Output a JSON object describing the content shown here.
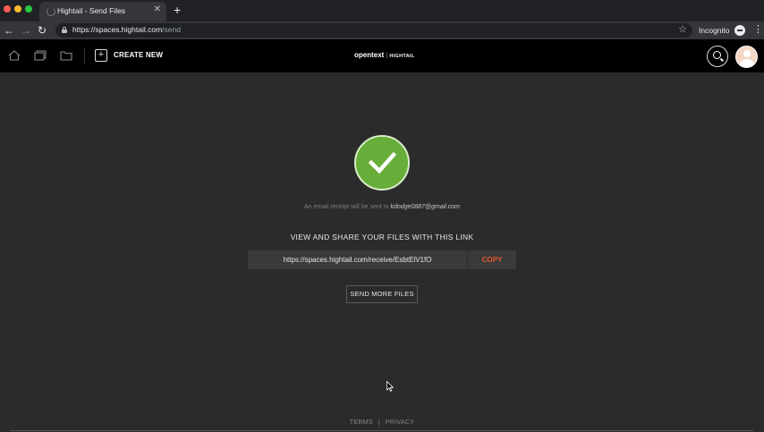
{
  "browser": {
    "tab_title": "Hightail - Send Files",
    "url_host": "https://spaces.hightail.com",
    "url_path": "/send",
    "incognito_label": "Incognito"
  },
  "header": {
    "create_new_label": "CREATE NEW",
    "logo_brand": "opentext",
    "logo_product": "HIGHTAIL"
  },
  "main": {
    "receipt_prefix": "An email receipt will be sent to",
    "receipt_email": "kdodge0887@gmail.com",
    "share_heading": "VIEW AND SHARE YOUR FILES WITH THIS LINK",
    "share_link": "https://spaces.hightail.com/receive/EsbtElV1fO",
    "copy_label": "COPY",
    "send_more_label": "SEND MORE FILES"
  },
  "footer": {
    "terms": "TERMS",
    "separator": "|",
    "privacy": "PRIVACY"
  },
  "colors": {
    "success_green": "#67ad3a",
    "copy_accent": "#e4552f",
    "header_bg": "#000000",
    "page_bg": "#2b2b2c"
  }
}
